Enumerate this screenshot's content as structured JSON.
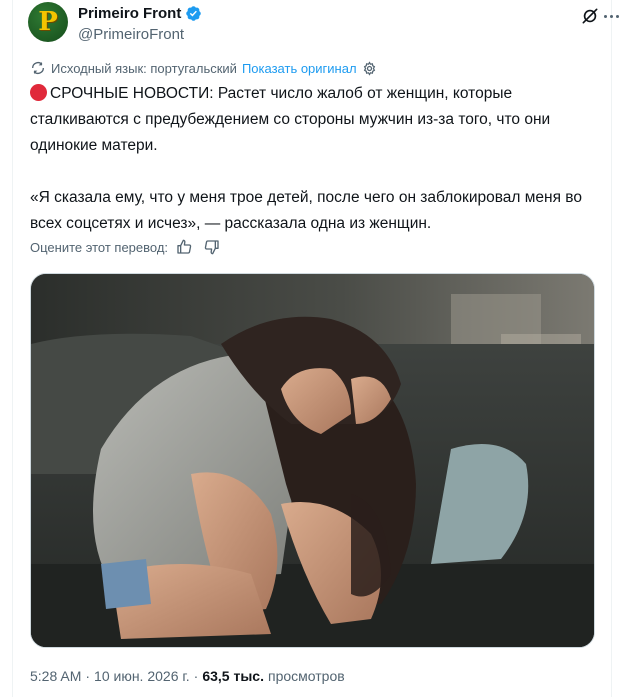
{
  "author": {
    "display_name": "Primeiro Front",
    "handle": "@PrimeiroFront",
    "avatar_letter": "P"
  },
  "translation": {
    "source_language": "Исходный язык: португальский",
    "show_original": "Показать оригинал"
  },
  "tweet": {
    "line1": "СРОЧНЫЕ НОВОСТИ: Растет число жалоб от женщин, которые сталкиваются с предубеждением со стороны мужчин из-за того, что они одинокие матери.",
    "line2": "«Я сказала ему, что у меня трое детей, после чего он заблокировал меня во всех соцсетях и исчез», — рассказала одна из женщин."
  },
  "rating": {
    "label": "Оцените этот перевод:"
  },
  "meta": {
    "time": "5:28 AM",
    "date": "10 июн. 2026 г.",
    "views_count": "63,5 тыс.",
    "views_label": "просмотров",
    "separator": "·"
  },
  "colors": {
    "accent": "#1d9bf0",
    "muted": "#536471",
    "text": "#0f1419",
    "red_dot": "#e0293a"
  }
}
